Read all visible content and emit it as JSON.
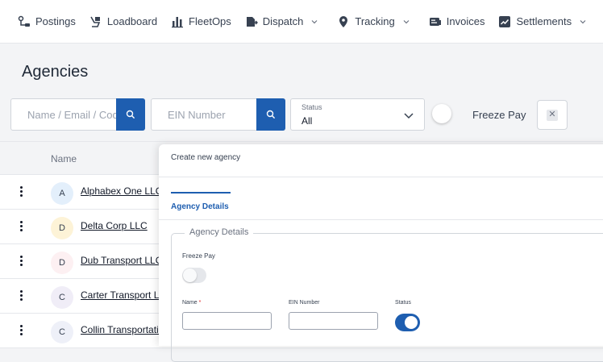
{
  "nav": {
    "items": [
      {
        "label": "Postings",
        "icon": "postings-icon",
        "dropdown": false
      },
      {
        "label": "Loadboard",
        "icon": "loadboard-icon",
        "dropdown": false
      },
      {
        "label": "FleetOps",
        "icon": "bar-chart-icon",
        "dropdown": false
      },
      {
        "label": "Dispatch",
        "icon": "dispatch-icon",
        "dropdown": true
      },
      {
        "label": "Tracking",
        "icon": "location-pin-icon",
        "dropdown": true
      },
      {
        "label": "Invoices",
        "icon": "invoices-icon",
        "dropdown": false
      },
      {
        "label": "Settlements",
        "icon": "settlements-icon",
        "dropdown": true
      }
    ]
  },
  "page": {
    "title": "Agencies"
  },
  "filters": {
    "search_placeholder": "Name / Email / Code",
    "ein_placeholder": "EIN Number",
    "status_label": "Status",
    "status_value": "All",
    "freeze_pay_label": "Freeze Pay"
  },
  "table": {
    "header_name": "Name",
    "rows": [
      {
        "initial": "A",
        "name": "Alphabex One LLC",
        "avatar_bg": "#e3effb",
        "avatar_fg": "#374151"
      },
      {
        "initial": "D",
        "name": "Delta Corp LLC",
        "avatar_bg": "#fdf3d7",
        "avatar_fg": "#374151"
      },
      {
        "initial": "D",
        "name": "Dub Transport LLC",
        "avatar_bg": "#fdf0f2",
        "avatar_fg": "#374151"
      },
      {
        "initial": "C",
        "name": "Carter Transport LLC",
        "avatar_bg": "#f0edf7",
        "avatar_fg": "#374151"
      },
      {
        "initial": "C",
        "name": "Collin Transportation",
        "avatar_bg": "#eef0f8",
        "avatar_fg": "#374151"
      }
    ]
  },
  "modal": {
    "title": "Create new agency",
    "tab_label": "Agency Details",
    "section_legend": "Agency Details",
    "freeze_pay_label": "Freeze Pay",
    "freeze_pay_on": false,
    "name_label": "Name",
    "name_required_mark": "*",
    "ein_label": "EIN Number",
    "status_label": "Status",
    "status_on": true
  },
  "colors": {
    "accent": "#1e5eb0"
  }
}
